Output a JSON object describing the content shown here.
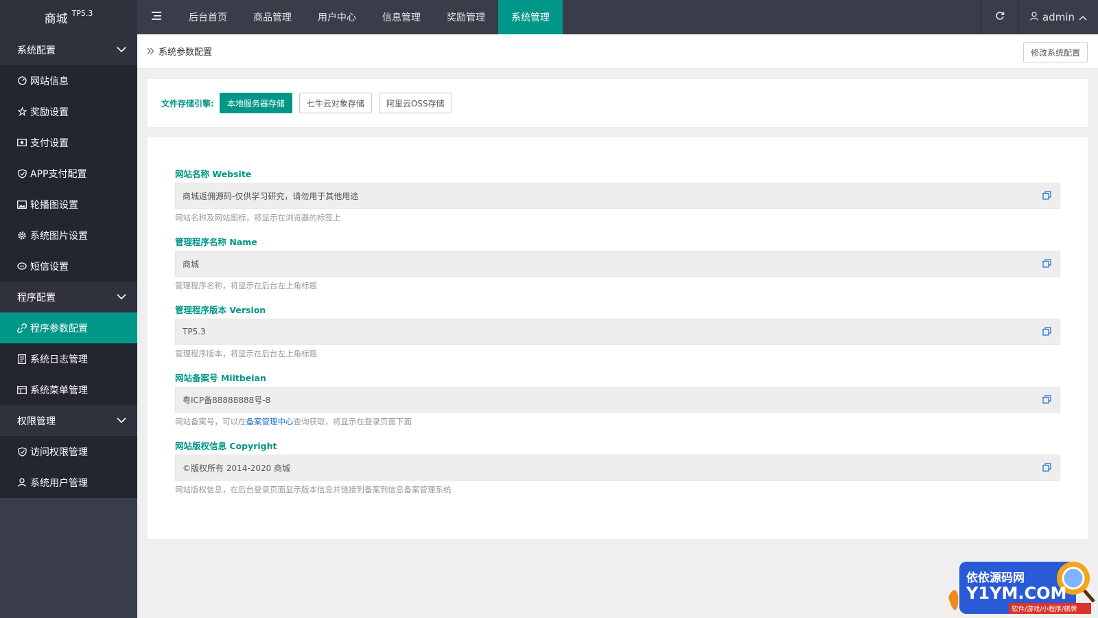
{
  "app": {
    "name": "商城",
    "version": "TP5.3"
  },
  "topnav": [
    "后台首页",
    "商品管理",
    "用户中心",
    "信息管理",
    "奖励管理",
    "系统管理"
  ],
  "user": {
    "name": "admin"
  },
  "sidebar": {
    "group1": {
      "title": "系统配置",
      "items": [
        "网站信息",
        "奖励设置",
        "支付设置",
        "APP支付配置",
        "轮播图设置",
        "系统图片设置",
        "短信设置"
      ]
    },
    "group2": {
      "title": "程序配置",
      "items": [
        "程序参数配置",
        "系统日志管理",
        "系统菜单管理"
      ]
    },
    "group3": {
      "title": "权限管理",
      "items": [
        "访问权限管理",
        "系统用户管理"
      ]
    }
  },
  "breadcrumb": {
    "text": "系统参数配置",
    "edit_button": "修改系统配置"
  },
  "storage": {
    "label": "文件存储引擎:",
    "options": [
      "本地服务器存储",
      "七牛云对象存储",
      "阿里云OSS存储"
    ],
    "selected": "本地服务器存储"
  },
  "fields": [
    {
      "label": "网站名称 Website",
      "value": "商城返佣源码-仅供学习研究，请勿用于其他用途",
      "help": "网站名称及网站图标，将显示在浏览器的标签上"
    },
    {
      "label": "管理程序名称 Name",
      "value": "商城",
      "help": "管理程序名称，将显示在后台左上角标题"
    },
    {
      "label": "管理程序版本 Version",
      "value": "TP5.3",
      "help": "管理程序版本，将显示在后台左上角标题"
    },
    {
      "label": "网站备案号 Miitbeian",
      "value": "粤ICP备88888888号-8",
      "help_pre": "网站备案号，可以在",
      "help_link": "备案管理中心",
      "help_post": "查询获取，将显示在登录页面下面"
    },
    {
      "label": "网站版权信息 Copyright",
      "value": "©版权所有 2014-2020 商城",
      "help": "网站版权信息，在后台登录页面显示版本信息并链接到备案到信息备案管理系统"
    }
  ],
  "watermark": {
    "line1": "依依源码网",
    "line2": "Y1YM.COM",
    "line3": "软件/游戏/小程序/棋牌"
  },
  "colors": {
    "accent": "#009688",
    "topbar": "#393d49",
    "sidebar_dark": "#23262e"
  }
}
